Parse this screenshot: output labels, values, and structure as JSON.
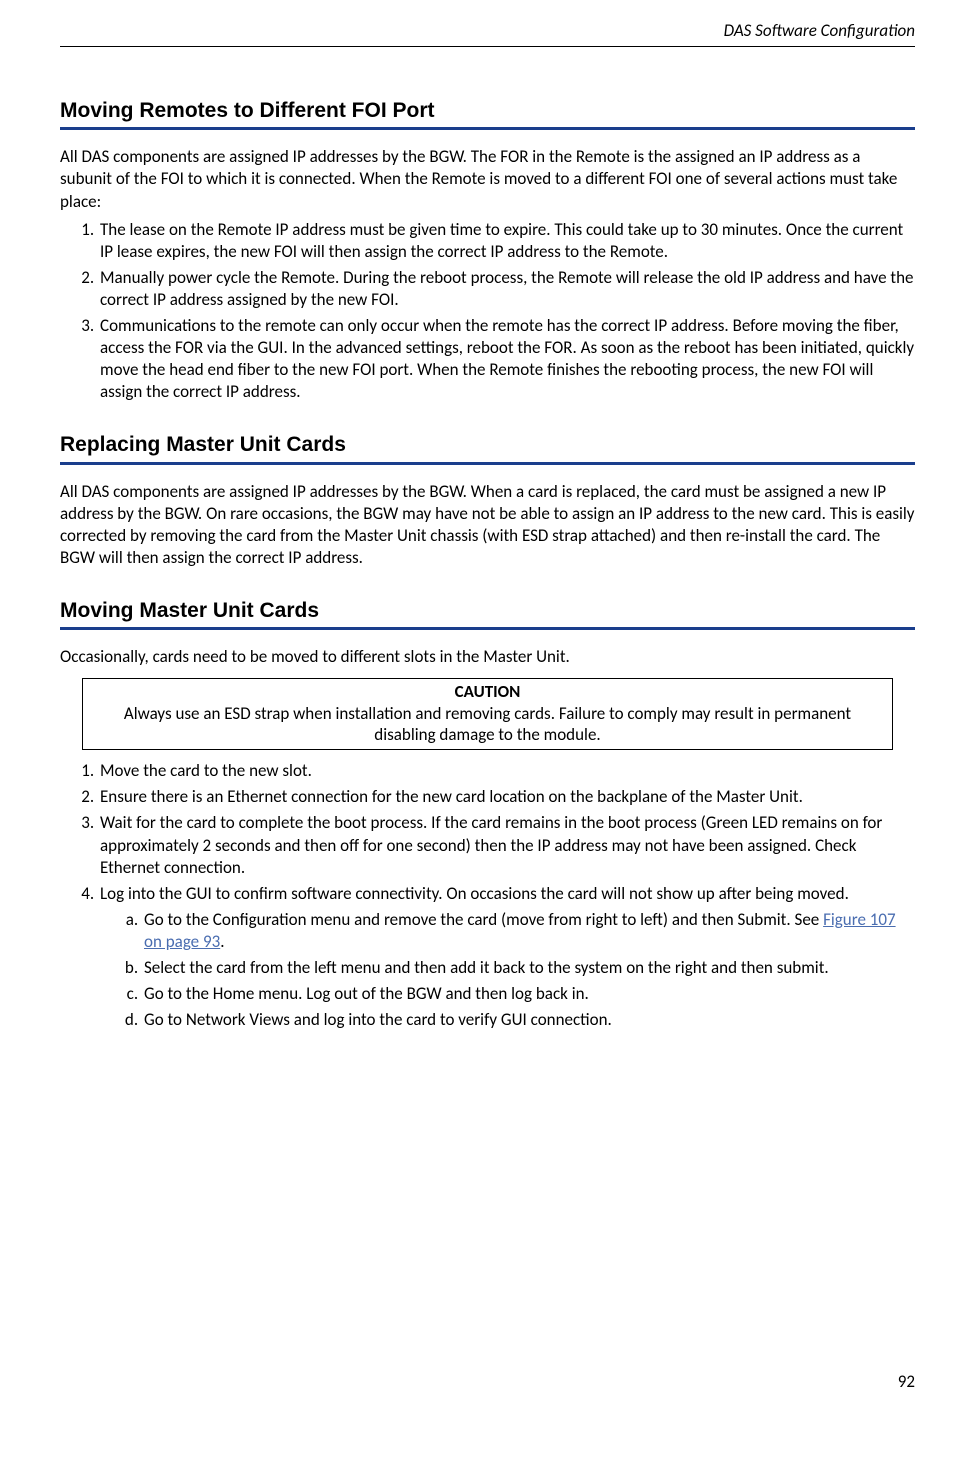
{
  "header": {
    "title": "DAS Software Configuration"
  },
  "section1": {
    "heading": "Moving Remotes to Different FOI Port",
    "intro": "All DAS components are assigned IP addresses by the BGW. The FOR in the Remote is the assigned an IP address as a subunit of the FOI to which it is connected. When the Remote is moved to a different FOI one of several actions must take place:",
    "items": [
      "The lease on the Remote IP address must be given time to expire. This could take up to 30 minutes. Once the current IP lease expires, the new FOI will then assign the correct IP address to the Remote.",
      "Manually power cycle the Remote. During the reboot process, the Remote will release the old IP address and have the correct IP address assigned by the new FOI.",
      "Communications to the remote can only occur when the remote has the correct IP address. Before moving the fiber, access the FOR via the GUI. In the advanced settings, reboot the FOR. As soon as the reboot has been initiated, quickly move the head end fiber to the new FOI port. When the Remote finishes the rebooting process, the new FOI will assign the correct IP address."
    ]
  },
  "section2": {
    "heading": "Replacing Master Unit Cards",
    "para": "All DAS components are assigned IP addresses by the BGW. When a card is replaced, the card must be assigned a new IP address by the BGW. On rare occasions, the BGW may have not be able to assign an IP address to the new card. This is easily corrected by removing the card from the Master Unit chassis (with ESD strap attached) and then re-install the card. The BGW will then assign the correct IP address."
  },
  "section3": {
    "heading": "Moving Master Unit Cards",
    "intro": "Occasionally, cards need to be moved to different slots in the Master Unit.",
    "caution_label": "CAUTION",
    "caution_text": "Always use an ESD strap when installation and removing cards. Failure to comply may result in permanent disabling damage to the module.",
    "items": {
      "i1": "Move the card to the new slot.",
      "i2": "Ensure there is an Ethernet connection for the new card location on the backplane of the Master Unit.",
      "i3": "Wait for the card to complete the boot process. If the card remains in the boot process (Green LED remains on for approximately 2 seconds and then off for one second) then the IP address may not have been assigned. Check Ethernet connection.",
      "i4": "Log into the GUI to confirm software connectivity. On occasions the card will not show up after being moved.",
      "i4a_pre": "Go to the Configuration menu and remove the card (move from right to left) and then Submit. See ",
      "i4a_link": "Figure 107 on page 93",
      "i4a_post": ".",
      "i4b": "Select the card from the left menu and then add it back to the system on the right and then submit.",
      "i4c": "Go to the Home menu. Log out of the BGW and then log back in.",
      "i4d": "Go to Network Views and log into the card to verify GUI connection."
    }
  },
  "page_number": "92"
}
